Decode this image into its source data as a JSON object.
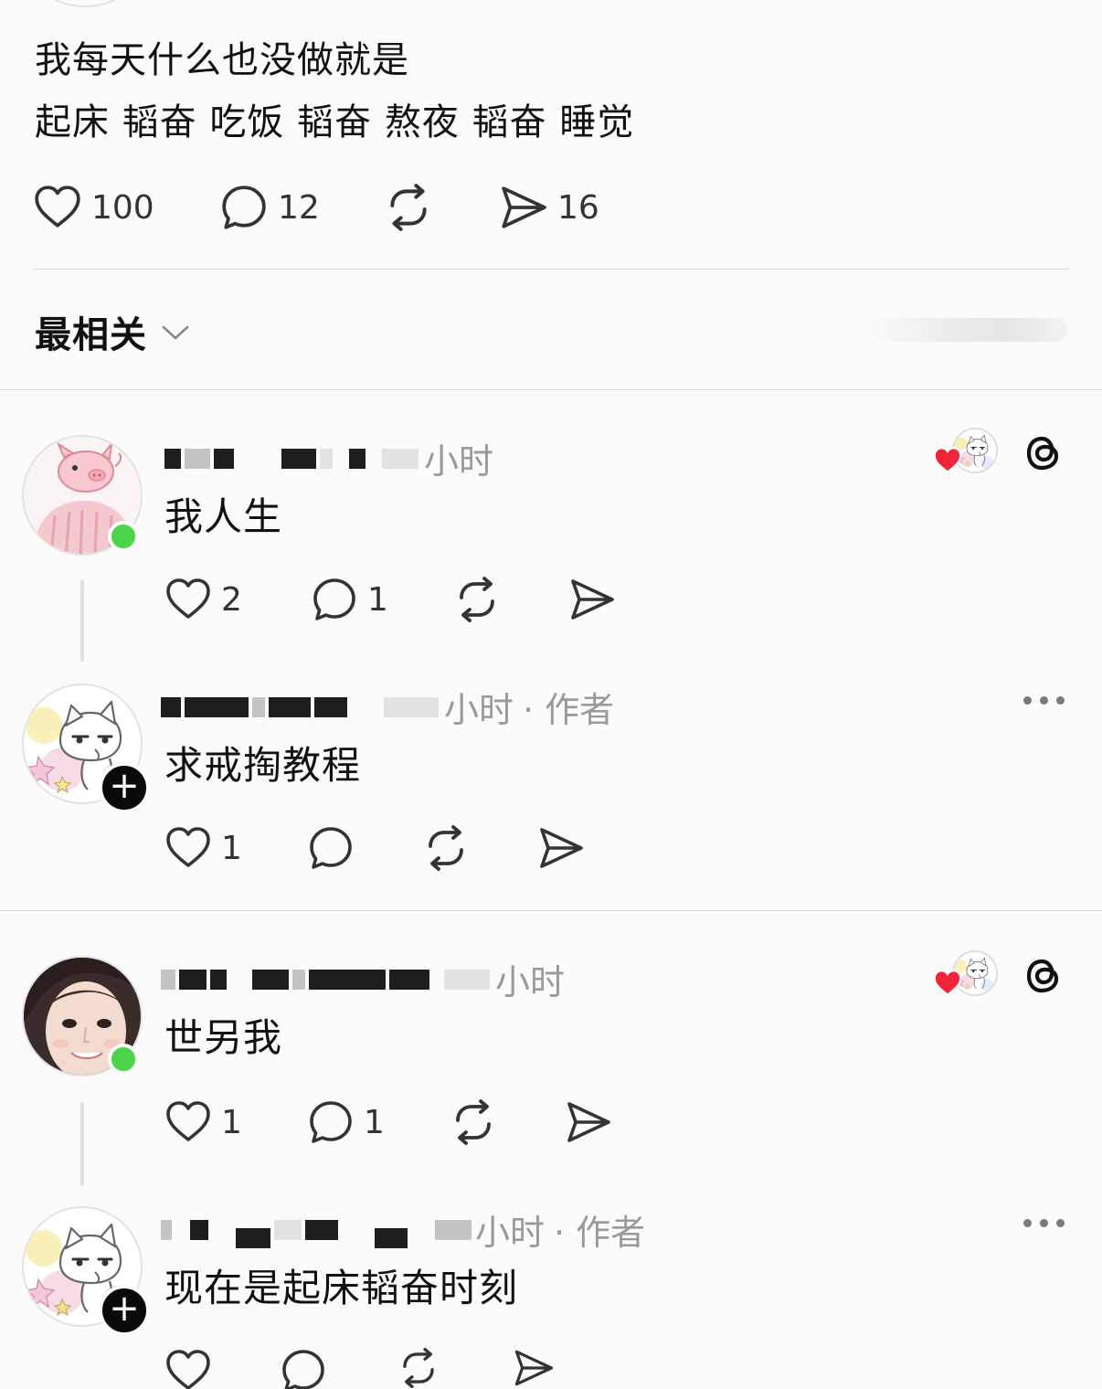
{
  "post": {
    "line1": "我每天什么也没做就是",
    "line2": "起床 韬奋 吃饭 韬奋 熬夜 韬奋 睡觉",
    "likes": "100",
    "comments": "12",
    "shares": "16"
  },
  "sort": {
    "label": "最相关"
  },
  "replies": [
    {
      "time": "小时",
      "text": "我人生",
      "likes": "2",
      "comments": "1"
    },
    {
      "time": "小时",
      "author_tag": "· 作者",
      "text": "求戒掏教程",
      "likes": "1"
    },
    {
      "time": "小时",
      "text": "世另我",
      "likes": "1",
      "comments": "1"
    },
    {
      "time": "小时",
      "author_tag": "· 作者",
      "text": "现在是起床韬奋时刻"
    }
  ],
  "colors": {
    "heart_red": "#f0243a",
    "online_green": "#4bd34a",
    "badge_black": "#0a0a0a"
  },
  "icons": [
    "heart-icon",
    "comment-icon",
    "repost-icon",
    "share-icon",
    "threads-icon",
    "more-icon",
    "chevron-down-icon",
    "plus-icon"
  ]
}
